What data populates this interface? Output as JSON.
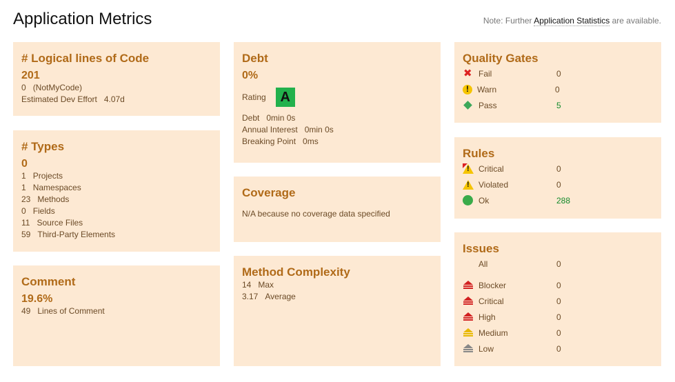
{
  "page": {
    "title": "Application Metrics",
    "note_prefix": "Note: Further ",
    "note_link": "Application Statistics",
    "note_suffix": " are available."
  },
  "loc": {
    "title": "# Logical lines of Code",
    "value": "201",
    "lines": [
      {
        "k": "0",
        "v": "(NotMyCode)"
      },
      {
        "k": "Estimated Dev Effort",
        "v": "4.07d"
      }
    ]
  },
  "types": {
    "title": "# Types",
    "value": "0",
    "lines": [
      {
        "k": "1",
        "v": "Projects"
      },
      {
        "k": "1",
        "v": "Namespaces"
      },
      {
        "k": "23",
        "v": "Methods"
      },
      {
        "k": "0",
        "v": "Fields"
      },
      {
        "k": "11",
        "v": "Source Files"
      },
      {
        "k": "59",
        "v": "Third-Party Elements"
      }
    ]
  },
  "comment": {
    "title": "Comment",
    "value": "19.6%",
    "lines": [
      {
        "k": "49",
        "v": "Lines of Comment"
      }
    ]
  },
  "debt": {
    "title": "Debt",
    "value": "0%",
    "rating_label": "Rating",
    "rating": "A",
    "lines": [
      {
        "k": "Debt",
        "v": "0min 0s"
      },
      {
        "k": "Annual Interest",
        "v": "0min 0s"
      },
      {
        "k": "Breaking Point",
        "v": "0ms"
      }
    ]
  },
  "coverage": {
    "title": "Coverage",
    "text": "N/A because no coverage data specified"
  },
  "complexity": {
    "title": "Method Complexity",
    "lines": [
      {
        "k": "14",
        "v": "Max"
      },
      {
        "k": "3.17",
        "v": "Average"
      }
    ]
  },
  "quality_gates": {
    "title": "Quality Gates",
    "rows": [
      {
        "icon": "fail-icon",
        "label": "Fail",
        "value": "0"
      },
      {
        "icon": "warning-icon",
        "label": "Warn",
        "value": "0"
      },
      {
        "icon": "pass-icon",
        "label": "Pass",
        "value": "5"
      }
    ]
  },
  "rules": {
    "title": "Rules",
    "rows": [
      {
        "icon": "critical-rule-icon",
        "label": "Critical",
        "value": "0"
      },
      {
        "icon": "violated-rule-icon",
        "label": "Violated",
        "value": "0"
      },
      {
        "icon": "ok-icon",
        "label": "Ok",
        "value": "288"
      }
    ]
  },
  "issues": {
    "title": "Issues",
    "rows": [
      {
        "icon": "",
        "label": "All",
        "value": "0"
      },
      {
        "icon": "blocker-icon",
        "label": "Blocker",
        "value": "0"
      },
      {
        "icon": "critical-icon",
        "label": "Critical",
        "value": "0"
      },
      {
        "icon": "high-icon",
        "label": "High",
        "value": "0"
      },
      {
        "icon": "medium-icon",
        "label": "Medium",
        "value": "0"
      },
      {
        "icon": "low-icon",
        "label": "Low",
        "value": "0"
      }
    ]
  },
  "colors": {
    "card_bg": "#fde9d3",
    "heading": "#b06a18",
    "rating_a": "#22b14c",
    "severity_red": "#d22222",
    "severity_yellow": "#e8b800",
    "severity_gray": "#888888"
  }
}
